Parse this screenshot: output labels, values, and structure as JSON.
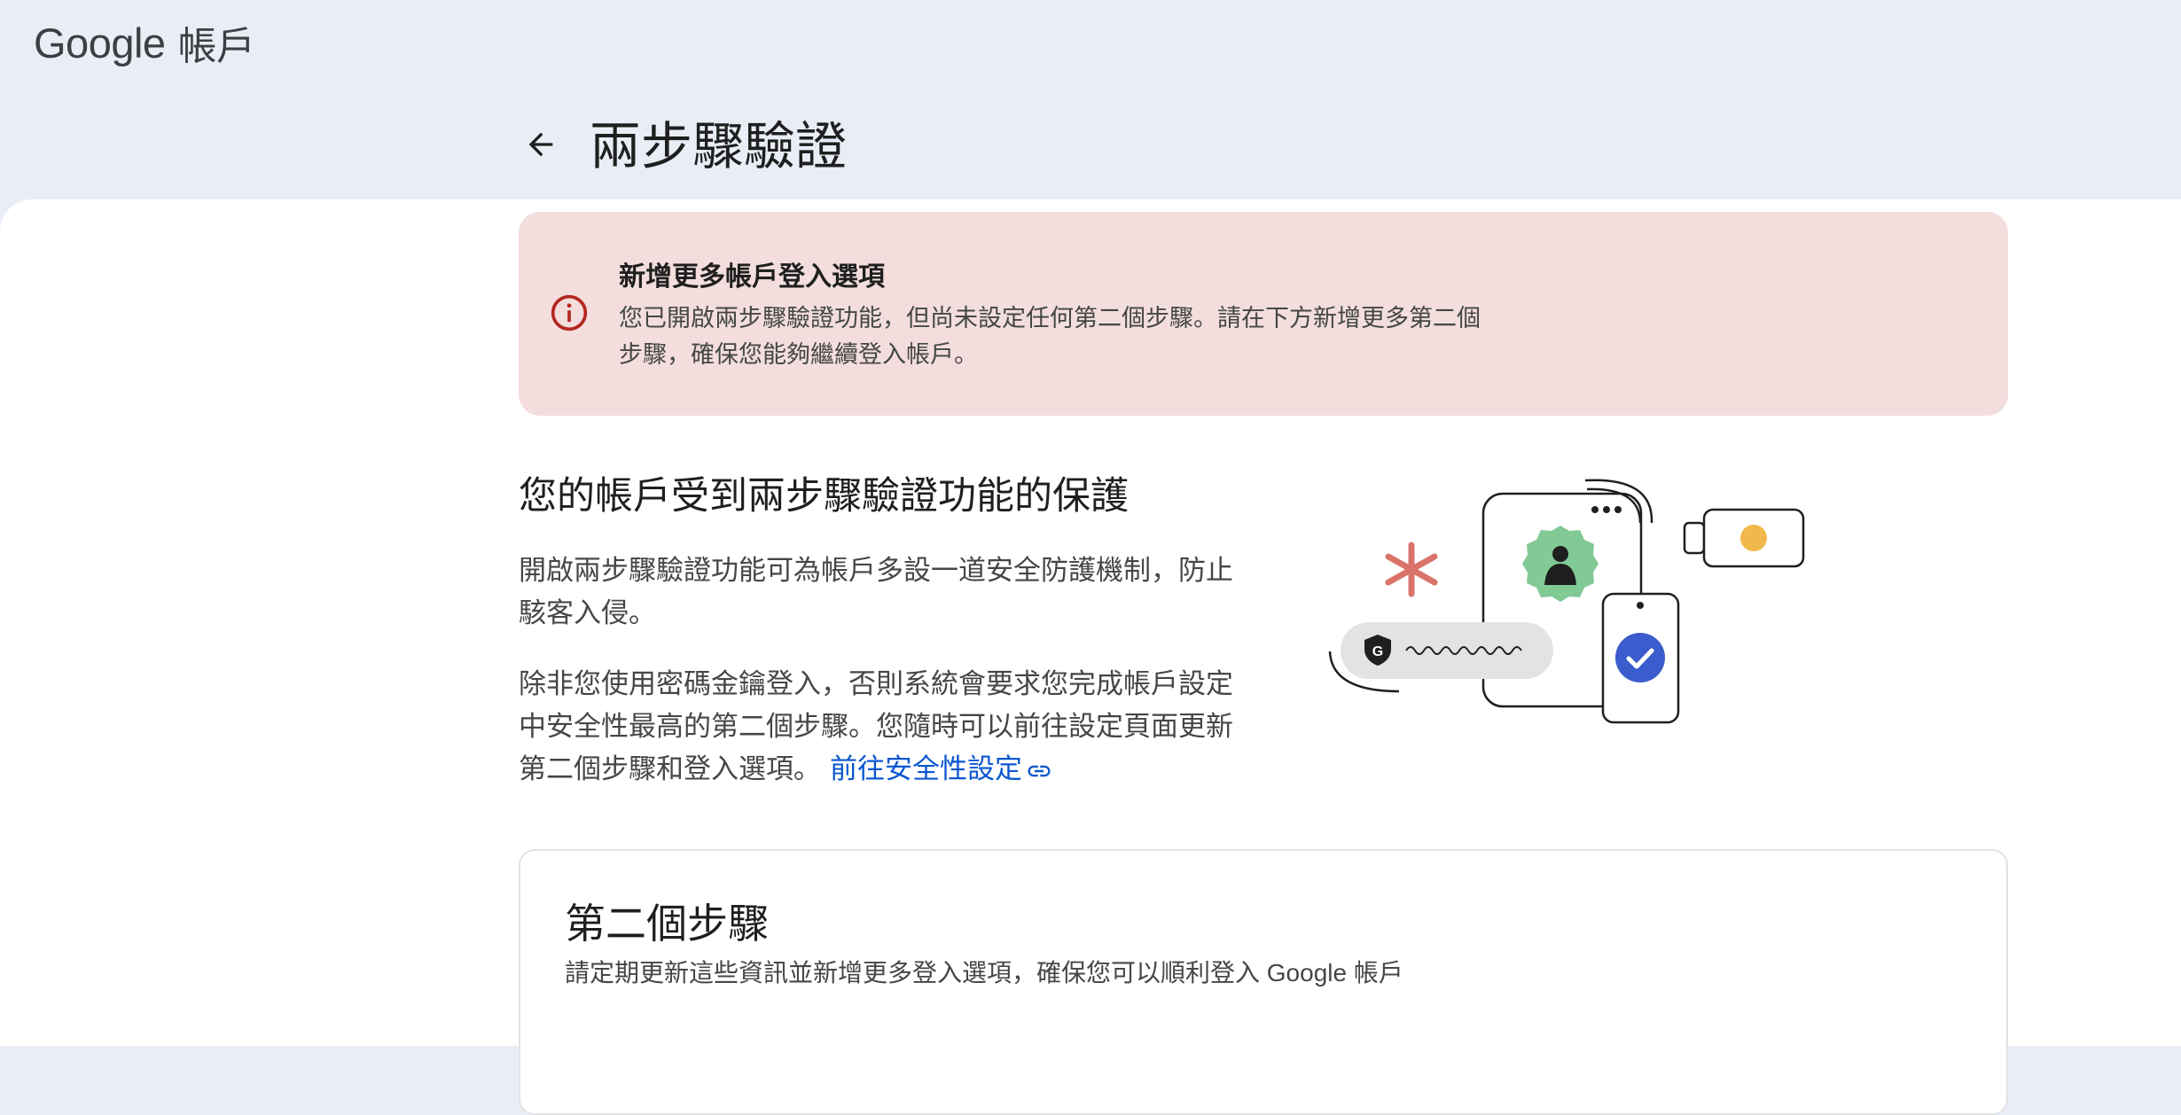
{
  "header": {
    "brand": "Google",
    "product": "帳戶"
  },
  "page": {
    "title": "兩步驟驗證"
  },
  "alert": {
    "title": "新增更多帳戶登入選項",
    "body": "您已開啟兩步驟驗證功能，但尚未設定任何第二個步驟。請在下方新增更多第二個步驟，確保您能夠繼續登入帳戶。",
    "icon": "info-icon",
    "color": "#b3261e"
  },
  "intro": {
    "heading": "您的帳戶受到兩步驟驗證功能的保護",
    "paragraph1": "開啟兩步驟驗證功能可為帳戶多設一道安全防護機制，防止駭客入侵。",
    "paragraph2": "除非您使用密碼金鑰登入，否則系統會要求您完成帳戶設定中安全性最高的第二個步驟。您隨時可以前往設定頁面更新第二個步驟和登入選項。",
    "link_label": "前往安全性設定",
    "link_icon": "link-icon"
  },
  "second_steps": {
    "title": "第二個步驟",
    "subtitle": "請定期更新這些資訊並新增更多登入選項，確保您可以順利登入 Google 帳戶"
  },
  "colors": {
    "accent": "#0b57d0",
    "alert_bg": "#f3dddd",
    "header_bg": "#e9eef6",
    "avatar_badge": "#81c995",
    "check_badge": "#3b5ccc",
    "key_dot": "#f2b84b",
    "asterisk": "#d9736a"
  }
}
